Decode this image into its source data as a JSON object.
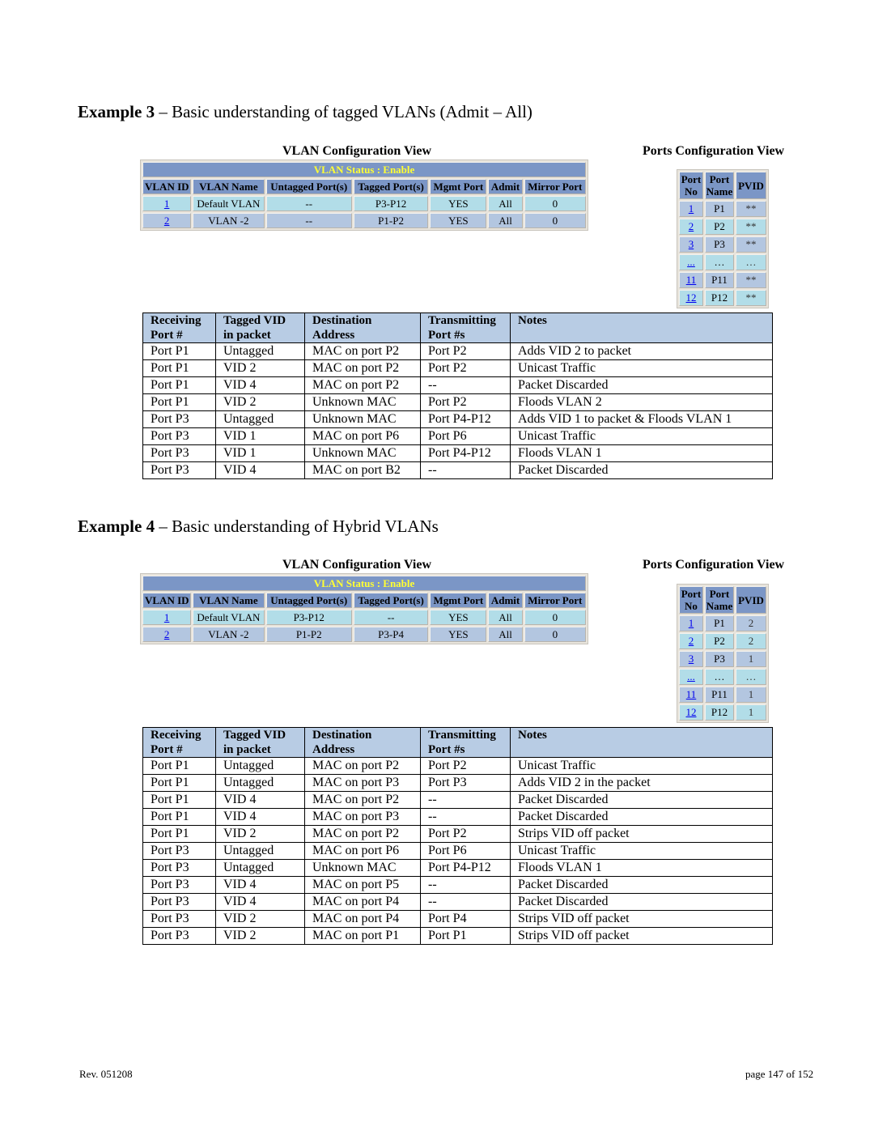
{
  "example3": {
    "heading_bold": "Example 3",
    "heading_rest": " – Basic understanding of tagged VLANs (Admit – All)",
    "vlan_config": {
      "title": "VLAN Configuration View",
      "status_label": "VLAN Status   :   Enable",
      "headers": [
        "VLAN ID",
        "VLAN Name",
        "Untagged Port(s)",
        "Tagged Port(s)",
        "Mgmt Port",
        "Admit",
        "Mirror Port"
      ],
      "rows": [
        [
          "1",
          "Default VLAN",
          "--",
          "P3-P12",
          "YES",
          "All",
          "0"
        ],
        [
          "2",
          "VLAN -2",
          "--",
          "P1-P2",
          "YES",
          "All",
          "0"
        ]
      ]
    },
    "ports_config": {
      "title": "Ports Configuration View",
      "headers": [
        "Port No",
        "Port Name",
        "PVID"
      ],
      "rows": [
        [
          "1",
          "P1",
          "**"
        ],
        [
          "2",
          "P2",
          "**"
        ],
        [
          "3",
          "P3",
          "**"
        ],
        [
          "...",
          "…",
          "…"
        ],
        [
          "11",
          "P11",
          "**"
        ],
        [
          "12",
          "P12",
          "**"
        ]
      ]
    },
    "behaviour": {
      "headers": [
        "Receiving Port #",
        "Tagged VID in packet",
        "Destination Address",
        "Transmitting Port #s",
        "Notes"
      ],
      "headers_line1": [
        "Receiving",
        "Tagged VID",
        "Destination",
        "Transmitting",
        "Notes"
      ],
      "headers_line2": [
        "Port #",
        "in packet",
        "Address",
        "Port #s",
        ""
      ],
      "rows": [
        [
          "Port P1",
          "Untagged",
          "MAC on port P2",
          "Port P2",
          "Adds VID 2 to packet"
        ],
        [
          "Port P1",
          "VID 2",
          "MAC on port P2",
          "Port P2",
          "Unicast Traffic"
        ],
        [
          "Port P1",
          "VID 4",
          "MAC on port P2",
          "--",
          "Packet Discarded"
        ],
        [
          "Port P1",
          "VID 2",
          "Unknown MAC",
          "Port P2",
          "Floods VLAN 2"
        ],
        [
          "Port P3",
          "Untagged",
          "Unknown MAC",
          "Port P4-P12",
          "Adds VID 1 to packet & Floods VLAN 1"
        ],
        [
          "Port P3",
          "VID 1",
          "MAC on port P6",
          "Port P6",
          "Unicast Traffic"
        ],
        [
          "Port P3",
          "VID 1",
          "Unknown MAC",
          "Port P4-P12",
          "Floods VLAN 1"
        ],
        [
          "Port P3",
          "VID 4",
          "MAC on port B2",
          "--",
          "Packet Discarded"
        ]
      ]
    }
  },
  "example4": {
    "heading_bold": "Example 4",
    "heading_rest": " – Basic understanding of Hybrid VLANs",
    "vlan_config": {
      "title": "VLAN Configuration View",
      "status_label": "VLAN Status   :   Enable",
      "headers": [
        "VLAN ID",
        "VLAN Name",
        "Untagged Port(s)",
        "Tagged Port(s)",
        "Mgmt Port",
        "Admit",
        "Mirror Port"
      ],
      "rows": [
        [
          "1",
          "Default VLAN",
          "P3-P12",
          "--",
          "YES",
          "All",
          "0"
        ],
        [
          "2",
          "VLAN -2",
          "P1-P2",
          "P3-P4",
          "YES",
          "All",
          "0"
        ]
      ]
    },
    "ports_config": {
      "title": "Ports Configuration View",
      "headers": [
        "Port No",
        "Port Name",
        "PVID"
      ],
      "rows": [
        [
          "1",
          "P1",
          "2"
        ],
        [
          "2",
          "P2",
          "2"
        ],
        [
          "3",
          "P3",
          "1"
        ],
        [
          "...",
          "…",
          "…"
        ],
        [
          "11",
          "P11",
          "1"
        ],
        [
          "12",
          "P12",
          "1"
        ]
      ]
    },
    "behaviour": {
      "headers_line1": [
        "Receiving",
        "Tagged VID",
        "Destination",
        "Transmitting",
        "Notes"
      ],
      "headers_line2": [
        "Port #",
        "in packet",
        "Address",
        "Port #s",
        ""
      ],
      "rows": [
        [
          "Port P1",
          "Untagged",
          "MAC on port P2",
          "Port P2",
          "Unicast Traffic"
        ],
        [
          "Port P1",
          "Untagged",
          "MAC on port P3",
          "Port P3",
          "Adds VID 2 in the packet"
        ],
        [
          "Port P1",
          "VID 4",
          "MAC on port P2",
          "--",
          "Packet Discarded"
        ],
        [
          "Port P1",
          "VID 4",
          "MAC on port P3",
          "--",
          "Packet Discarded"
        ],
        [
          "Port P1",
          "VID 2",
          "MAC on port P2",
          "Port P2",
          "Strips VID off packet"
        ],
        [
          "Port P3",
          "Untagged",
          "MAC on port P6",
          "Port P6",
          "Unicast Traffic"
        ],
        [
          "Port P3",
          "Untagged",
          "Unknown MAC",
          "Port P4-P12",
          "Floods VLAN 1"
        ],
        [
          "Port P3",
          "VID 4",
          "MAC on port P5",
          "--",
          "Packet Discarded"
        ],
        [
          "Port P3",
          "VID 4",
          "MAC on port P4",
          "--",
          "Packet Discarded"
        ],
        [
          "Port P3",
          "VID 2",
          "MAC on port P4",
          "Port P4",
          "Strips VID off packet"
        ],
        [
          "Port P3",
          "VID 2",
          "MAC on port P1",
          "Port P1",
          "Strips VID off packet"
        ]
      ]
    }
  },
  "footer": {
    "revision": "Rev.  051208",
    "page": "page 147 of 152"
  },
  "colors": {
    "header_blue": "#7b96c6",
    "status_yellow": "#ffff33",
    "row_cyan": "#b2dde8",
    "row_lavender": "#b3c6e0",
    "behaviour_header": "#b8cce4",
    "link": "#0000ee"
  }
}
